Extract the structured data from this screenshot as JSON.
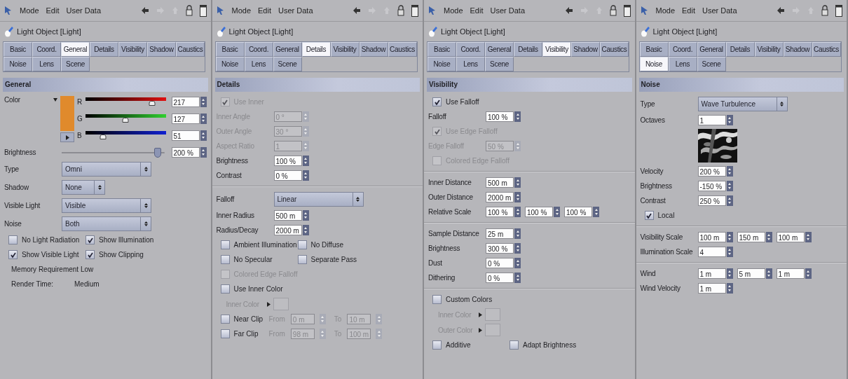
{
  "panels": [
    {
      "menu": [
        "Mode",
        "Edit",
        "User Data"
      ],
      "object_title": "Light Object [Light]",
      "tab_rows": [
        [
          {
            "label": "Basic",
            "selected": false
          },
          {
            "label": "Coord.",
            "selected": false
          },
          {
            "label": "General",
            "selected": true
          },
          {
            "label": "Details",
            "selected": false
          },
          {
            "label": "Visibility",
            "selected": false
          },
          {
            "label": "Shadow",
            "selected": false
          },
          {
            "label": "Caustics",
            "selected": false
          }
        ],
        [
          {
            "label": "Noise",
            "selected": false
          },
          {
            "label": "Lens",
            "selected": false
          },
          {
            "label": "Scene",
            "selected": false
          }
        ]
      ],
      "section": "General",
      "rows": [
        {
          "kind": "color",
          "label": "Color",
          "color": "#e08a2c",
          "channels": [
            {
              "letter": "R",
              "level": 0.85,
              "value": "217"
            },
            {
              "letter": "G",
              "level": 0.5,
              "value": "127"
            },
            {
              "letter": "B",
              "level": 0.2,
              "value": "51"
            }
          ]
        },
        {
          "kind": "slider",
          "label": "Brightness",
          "level": 0.97,
          "value": "200 %"
        },
        {
          "kind": "dropdown",
          "label": "Type",
          "value": "Omni"
        },
        {
          "kind": "dropdown-short",
          "label": "Shadow",
          "value": "None"
        },
        {
          "kind": "dropdown",
          "label": "Visible Light",
          "value": "Visible"
        },
        {
          "kind": "dropdown",
          "label": "Noise",
          "value": "Both"
        },
        {
          "kind": "checks",
          "items": [
            {
              "label": "No Light Radiation",
              "checked": false
            },
            {
              "label": "Show Illumination",
              "checked": true
            }
          ]
        },
        {
          "kind": "checks",
          "items": [
            {
              "label": "Show Visible Light",
              "checked": true
            },
            {
              "label": "Show Clipping",
              "checked": true
            }
          ]
        },
        {
          "kind": "note",
          "text": "Memory Requirement Low"
        },
        {
          "kind": "info",
          "label": "Render Time:",
          "value": "Medium"
        }
      ]
    },
    {
      "menu": [
        "Mode",
        "Edit",
        "User Data"
      ],
      "object_title": "Light Object [Light]",
      "tab_rows": [
        [
          {
            "label": "Basic",
            "selected": false
          },
          {
            "label": "Coord.",
            "selected": false
          },
          {
            "label": "General",
            "selected": false
          },
          {
            "label": "Details",
            "selected": true
          },
          {
            "label": "Visibility",
            "selected": false
          },
          {
            "label": "Shadow",
            "selected": false
          },
          {
            "label": "Caustics",
            "selected": false
          }
        ],
        [
          {
            "label": "Noise",
            "selected": false
          },
          {
            "label": "Lens",
            "selected": false
          },
          {
            "label": "Scene",
            "selected": false
          }
        ]
      ],
      "section": "Details",
      "rows": [
        {
          "kind": "check",
          "label": "Use Inner",
          "checked": true,
          "disabled": true
        },
        {
          "kind": "field",
          "label": "Inner Angle",
          "value": "0 °",
          "disabled": true
        },
        {
          "kind": "field",
          "label": "Outer Angle",
          "value": "30 °",
          "disabled": true
        },
        {
          "kind": "field",
          "label": "Aspect Ratio",
          "value": "1",
          "disabled": true
        },
        {
          "kind": "field",
          "label": "Brightness",
          "value": "100 %",
          "disabled": false
        },
        {
          "kind": "field",
          "label": "Contrast",
          "value": "0 %",
          "disabled": false
        },
        {
          "kind": "divider"
        },
        {
          "kind": "dropdown",
          "label": "Falloff",
          "value": "Linear"
        },
        {
          "kind": "field",
          "label": "Inner Radius",
          "value": "500 m",
          "disabled": false
        },
        {
          "kind": "field",
          "label": "Radius/Decay",
          "value": "2000 m",
          "disabled": false
        },
        {
          "kind": "checks",
          "items": [
            {
              "label": "Ambient Illumination",
              "checked": false
            },
            {
              "label": "No Diffuse",
              "checked": false
            }
          ]
        },
        {
          "kind": "checks",
          "items": [
            {
              "label": "No Specular",
              "checked": false
            },
            {
              "label": "Separate Pass",
              "checked": false
            }
          ]
        },
        {
          "kind": "check",
          "label": "Colored Edge Falloff",
          "checked": false,
          "disabled": true
        },
        {
          "kind": "check",
          "label": "Use Inner Color",
          "checked": false,
          "disabled": false
        },
        {
          "kind": "colorpick",
          "label": "Inner Color"
        },
        {
          "kind": "clip",
          "label": "Near Clip",
          "checked": false,
          "from_label": "From",
          "from": "0 m",
          "to_label": "To",
          "to": "10 m"
        },
        {
          "kind": "clip",
          "label": "Far Clip",
          "checked": false,
          "from_label": "From",
          "from": "98 m",
          "to_label": "To",
          "to": "100 m"
        }
      ]
    },
    {
      "menu": [
        "Mode",
        "Edit",
        "User Data"
      ],
      "object_title": "Light Object [Light]",
      "tab_rows": [
        [
          {
            "label": "Basic",
            "selected": false
          },
          {
            "label": "Coord.",
            "selected": false
          },
          {
            "label": "General",
            "selected": false
          },
          {
            "label": "Details",
            "selected": false
          },
          {
            "label": "Visibility",
            "selected": true
          },
          {
            "label": "Shadow",
            "selected": false
          },
          {
            "label": "Caustics",
            "selected": false
          }
        ],
        [
          {
            "label": "Noise",
            "selected": false
          },
          {
            "label": "Lens",
            "selected": false
          },
          {
            "label": "Scene",
            "selected": false
          }
        ]
      ],
      "section": "Visibility",
      "rows": [
        {
          "kind": "check",
          "label": "Use Falloff",
          "checked": true,
          "disabled": false
        },
        {
          "kind": "field",
          "label": "Falloff",
          "value": "100 %",
          "disabled": false
        },
        {
          "kind": "check",
          "label": "Use Edge Falloff",
          "checked": true,
          "disabled": true
        },
        {
          "kind": "field",
          "label": "Edge Falloff",
          "value": "50 %",
          "disabled": true
        },
        {
          "kind": "check",
          "label": "Colored Edge Falloff",
          "checked": false,
          "disabled": true
        },
        {
          "kind": "divider"
        },
        {
          "kind": "field",
          "label": "Inner Distance",
          "value": "500 m",
          "disabled": false
        },
        {
          "kind": "field",
          "label": "Outer Distance",
          "value": "2000 m",
          "disabled": false
        },
        {
          "kind": "fields",
          "label": "Relative Scale",
          "values": [
            "100 %",
            "100 %",
            "100 %"
          ]
        },
        {
          "kind": "divider"
        },
        {
          "kind": "field",
          "label": "Sample Distance",
          "value": "25 m",
          "disabled": false
        },
        {
          "kind": "field",
          "label": "Brightness",
          "value": "300 %",
          "disabled": false
        },
        {
          "kind": "field",
          "label": "Dust",
          "value": "0 %",
          "disabled": false
        },
        {
          "kind": "field",
          "label": "Dithering",
          "value": "0 %",
          "disabled": false
        },
        {
          "kind": "divider"
        },
        {
          "kind": "check",
          "label": "Custom Colors",
          "checked": false,
          "disabled": false
        },
        {
          "kind": "colorpick",
          "label": "Inner Color"
        },
        {
          "kind": "colorpick",
          "label": "Outer Color"
        },
        {
          "kind": "checks",
          "items": [
            {
              "label": "Additive",
              "checked": false
            },
            {
              "label": "Adapt Brightness",
              "checked": false
            }
          ]
        }
      ]
    },
    {
      "menu": [
        "Mode",
        "Edit",
        "User Data"
      ],
      "object_title": "Light Object [Light]",
      "tab_rows": [
        [
          {
            "label": "Basic",
            "selected": false
          },
          {
            "label": "Coord.",
            "selected": false
          },
          {
            "label": "General",
            "selected": false
          },
          {
            "label": "Details",
            "selected": false
          },
          {
            "label": "Visibility",
            "selected": false
          },
          {
            "label": "Shadow",
            "selected": false
          },
          {
            "label": "Caustics",
            "selected": false
          }
        ],
        [
          {
            "label": "Noise",
            "selected": true
          },
          {
            "label": "Lens",
            "selected": false
          },
          {
            "label": "Scene",
            "selected": false
          }
        ]
      ],
      "section": "Noise",
      "rows": [
        {
          "kind": "dropdown",
          "label": "Type",
          "value": "Wave Turbulence"
        },
        {
          "kind": "field",
          "label": "Octaves",
          "value": "1",
          "disabled": false
        },
        {
          "kind": "picture"
        },
        {
          "kind": "field",
          "label": "Velocity",
          "value": "200 %",
          "disabled": false
        },
        {
          "kind": "field",
          "label": "Brightness",
          "value": "-150 %",
          "disabled": false
        },
        {
          "kind": "field",
          "label": "Contrast",
          "value": "250 %",
          "disabled": false
        },
        {
          "kind": "check",
          "label": "Local",
          "checked": true,
          "disabled": false
        },
        {
          "kind": "divider"
        },
        {
          "kind": "fields",
          "label": "Visibility Scale",
          "values": [
            "100 m",
            "150 m",
            "100 m"
          ]
        },
        {
          "kind": "field",
          "label": "Illumination Scale",
          "value": "4",
          "disabled": false
        },
        {
          "kind": "divider"
        },
        {
          "kind": "fields",
          "label": "Wind",
          "values": [
            "1 m",
            "5 m",
            "1 m"
          ]
        },
        {
          "kind": "field",
          "label": "Wind Velocity",
          "value": "1 m",
          "disabled": false
        }
      ]
    }
  ]
}
